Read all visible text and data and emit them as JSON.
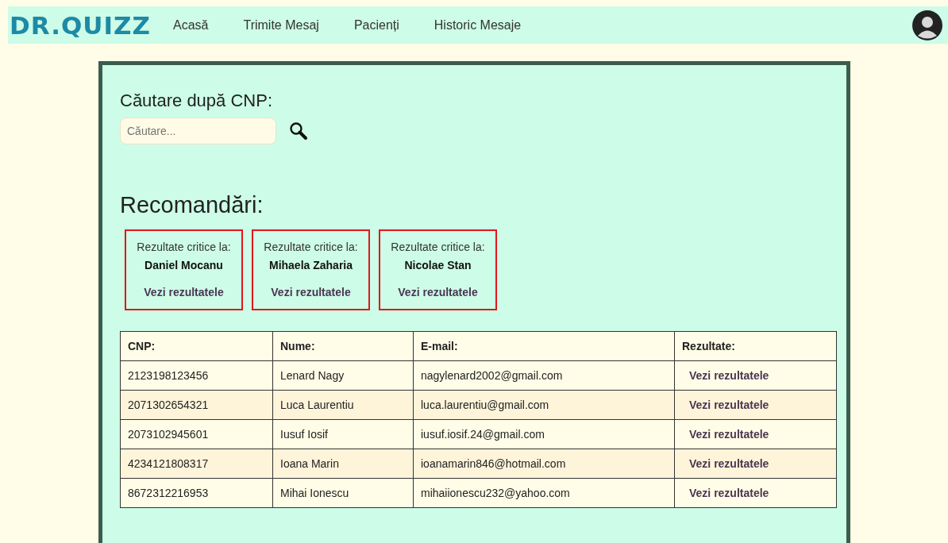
{
  "navbar": {
    "logo": "DR.QUIZZ",
    "links": [
      {
        "label": "Acasă"
      },
      {
        "label": "Trimite Mesaj"
      },
      {
        "label": "Pacienți"
      },
      {
        "label": "Historic Mesaje"
      }
    ]
  },
  "search": {
    "label": "Căutare după CNP:",
    "placeholder": "Căutare..."
  },
  "recommendations": {
    "title": "Recomandări:",
    "cards": [
      {
        "caption": "Rezultate critice la:",
        "name": "Daniel Mocanu",
        "link": "Vezi rezultatele"
      },
      {
        "caption": "Rezultate critice la:",
        "name": "Mihaela Zaharia",
        "link": "Vezi rezultatele"
      },
      {
        "caption": "Rezultate critice la:",
        "name": "Nicolae Stan",
        "link": "Vezi rezultatele"
      }
    ]
  },
  "table": {
    "columns": [
      "CNP:",
      "Nume:",
      "E-mail:",
      "Rezultate:"
    ],
    "rows": [
      {
        "cnp": "2123198123456",
        "name": "Lenard Nagy",
        "email": "nagylenard2002@gmail.com",
        "link": "Vezi rezultatele"
      },
      {
        "cnp": "2071302654321",
        "name": "Luca Laurentiu",
        "email": "luca.laurentiu@gmail.com",
        "link": "Vezi rezultatele"
      },
      {
        "cnp": "2073102945601",
        "name": "Iusuf Iosif",
        "email": "iusuf.iosif.24@gmail.com",
        "link": "Vezi rezultatele"
      },
      {
        "cnp": "4234121808317",
        "name": "Ioana Marin",
        "email": "ioanamarin846@hotmail.com",
        "link": "Vezi rezultatele"
      },
      {
        "cnp": "8672312216953",
        "name": "Mihai Ionescu",
        "email": "mihaiionescu232@yahoo.com",
        "link": "Vezi rezultatele"
      }
    ]
  }
}
